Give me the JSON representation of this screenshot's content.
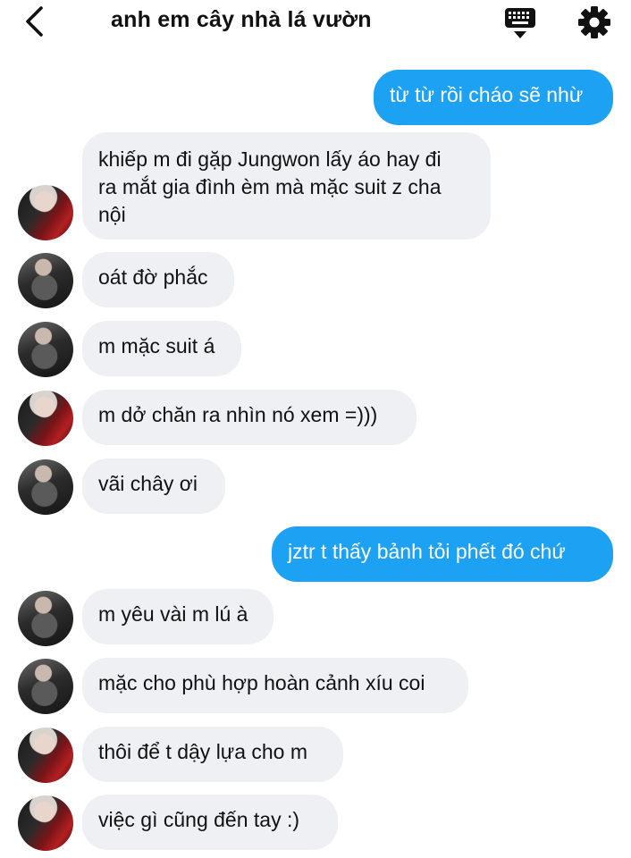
{
  "header": {
    "title": "anh em cây nhà lá vườn",
    "back_icon": "chevron-left-icon",
    "keyboard_icon": "keyboard-icon",
    "settings_icon": "gear-icon"
  },
  "colors": {
    "outgoing_bubble": "#1da1f2",
    "incoming_bubble": "#eef0f3"
  },
  "messages": [
    {
      "direction": "out",
      "text": "từ từ rồi cháo sẽ nhừ"
    },
    {
      "direction": "in",
      "avatar": "red",
      "text": "khiếp m đi gặp Jungwon lấy áo hay đi\nra mắt gia đình èm mà mặc suit z cha\nnội"
    },
    {
      "direction": "in",
      "avatar": "dark",
      "text": "oát đờ phắc"
    },
    {
      "direction": "in",
      "avatar": "dark",
      "text": "m mặc suit á"
    },
    {
      "direction": "in",
      "avatar": "red",
      "text": "m dở chăn ra nhìn nó xem =)))"
    },
    {
      "direction": "in",
      "avatar": "dark",
      "text": "vãi châу ơi"
    },
    {
      "direction": "out",
      "text": "jztr t thấy bảnh tỏi phết đó chứ"
    },
    {
      "direction": "in",
      "avatar": "dark",
      "text": "m yêu vài m lú à"
    },
    {
      "direction": "in",
      "avatar": "dark",
      "text": "mặc cho phù hợp hoàn cảnh xíu coi"
    },
    {
      "direction": "in",
      "avatar": "red",
      "text": "thôi để t dậy lựa cho m"
    },
    {
      "direction": "in",
      "avatar": "red",
      "text": "việc gì cũng đến tay :)"
    }
  ]
}
